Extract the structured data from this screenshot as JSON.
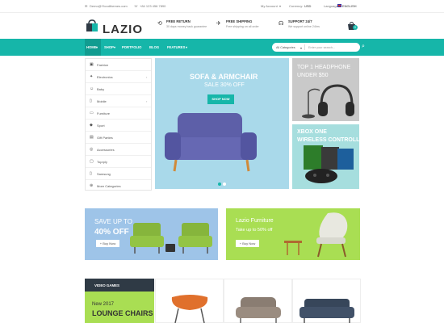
{
  "topbar": {
    "email": "Demo@Ytcodthemes.com",
    "phone": "+84 123 456 7890",
    "account_label": "My Account",
    "currency_label": "Currency:",
    "currency_value": "USD",
    "language_label": "Language:",
    "language_value": "ENGLISH"
  },
  "header": {
    "logo": "LAZIO",
    "features": [
      {
        "title": "FREE RETURN",
        "subtitle": "30 days money back guarantee"
      },
      {
        "title": "FREE SHIPPING",
        "subtitle": "Free shipping on all order"
      },
      {
        "title": "SUPPORT 24/7",
        "subtitle": "We support online 24hrs"
      }
    ],
    "cart_count": "0"
  },
  "nav": {
    "items": [
      "HOME",
      "SHOP",
      "PORTFOLIO",
      "BLOG",
      "FEATURES"
    ],
    "search_category": "All Categories",
    "search_placeholder": "Enter your search..."
  },
  "sidebar": {
    "items": [
      {
        "label": "Fashion",
        "icon": "fashion-icon"
      },
      {
        "label": "Electronics",
        "icon": "electronics-icon"
      },
      {
        "label": "Baby",
        "icon": "baby-icon"
      },
      {
        "label": "Mobile",
        "icon": "mobile-icon"
      },
      {
        "label": "Furniture",
        "icon": "furniture-icon"
      },
      {
        "label": "Sport",
        "icon": "sport-icon"
      },
      {
        "label": "Gift Parties",
        "icon": "gift-icon"
      },
      {
        "label": "Accessories",
        "icon": "accessories-icon"
      },
      {
        "label": "Toprply",
        "icon": "toy-icon"
      },
      {
        "label": "Samsung",
        "icon": "samsung-icon"
      },
      {
        "label": "More Categories",
        "icon": "plus-icon"
      }
    ]
  },
  "main_banner": {
    "title": "SOFA & ARMCHAIR",
    "subtitle": "SALE 30% OFF",
    "button": "SHOP NOW"
  },
  "side_banner_1": {
    "line1": "TOP 1 HEADPHONE",
    "line2": "UNDER $50"
  },
  "side_banner_2": {
    "line1": "XBOX ONE",
    "line2": "WIRELESS CONTROLLER"
  },
  "promo1": {
    "line1": "SAVE UP TO",
    "line2": "40% OFF",
    "button": "+ Buy Now"
  },
  "promo2": {
    "line1": "Lazio Furniture",
    "line2": "Take up to 50% off",
    "button": "+ Buy Now"
  },
  "video_games": {
    "heading": "VIDEO GAMES",
    "line1": "New 2017",
    "line2": "LOUNGE CHAIRS"
  },
  "colors": {
    "accent": "#16b6a9",
    "dark": "#2f3a45",
    "green": "#a9de53",
    "blue": "#9ec4e8"
  }
}
